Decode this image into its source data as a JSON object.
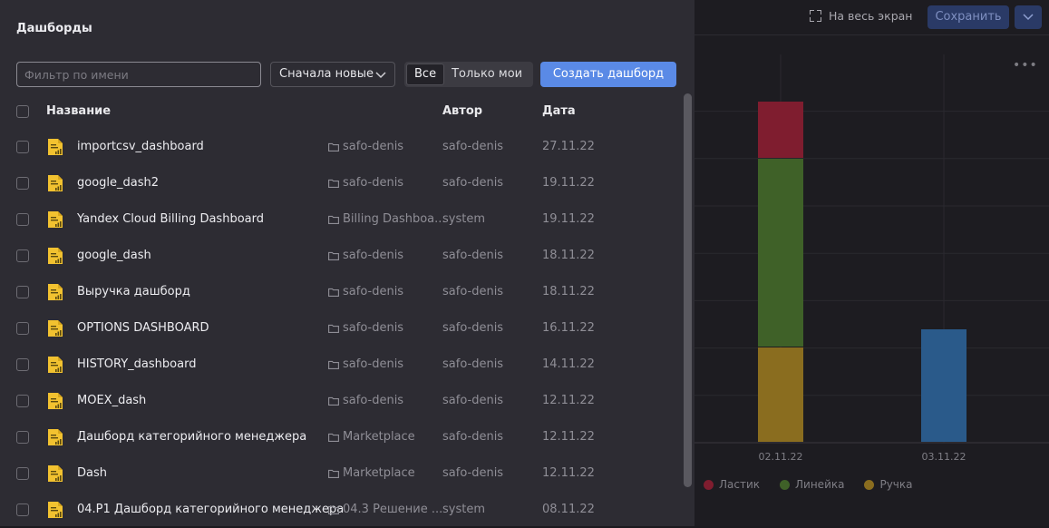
{
  "dashboard": {
    "fullscreen_label": "На весь экран",
    "save_label": "Сохранить",
    "more_label": "•••",
    "chart_data": {
      "type": "bar",
      "stacked": true,
      "categories": [
        "02.11.22",
        "03.11.22"
      ],
      "series": [
        {
          "name": "Ручка",
          "color": "#8a6d1f",
          "values": [
            105,
            0
          ]
        },
        {
          "name": "Линейка",
          "color": "#3f6128",
          "values": [
            208,
            0
          ]
        },
        {
          "name": "Ластик",
          "color": "#7f1d2f",
          "values": [
            63,
            0
          ]
        },
        {
          "name": "",
          "color": "#2a5a8a",
          "values": [
            0,
            125
          ]
        }
      ],
      "legend": [
        "Ластик",
        "Линейка",
        "Ручка"
      ],
      "legend_colors": [
        "#7f1d2f",
        "#3f6128",
        "#8a6d1f"
      ],
      "legend_position": "bottom-left",
      "grid": true
    }
  },
  "dialog": {
    "title": "Дашборды",
    "filter_placeholder": "Фильтр по имени",
    "filter_value": "",
    "sort_label": "Сначала новые",
    "segment_all": "Все",
    "segment_mine": "Только мои",
    "create_label": "Создать дашборд",
    "columns": {
      "name": "Название",
      "author": "Автор",
      "date": "Дата"
    },
    "rows": [
      {
        "name": "importcsv_dashboard",
        "folder": "safo-denis",
        "author": "safo-denis",
        "date": "27.11.22"
      },
      {
        "name": "google_dash2",
        "folder": "safo-denis",
        "author": "safo-denis",
        "date": "19.11.22"
      },
      {
        "name": "Yandex Cloud Billing Dashboard",
        "folder": "Billing Dashboa...",
        "author": "system",
        "date": "19.11.22"
      },
      {
        "name": "google_dash",
        "folder": "safo-denis",
        "author": "safo-denis",
        "date": "18.11.22"
      },
      {
        "name": "Выручка дашборд",
        "folder": "safo-denis",
        "author": "safo-denis",
        "date": "18.11.22"
      },
      {
        "name": "OPTIONS DASHBOARD",
        "folder": "safo-denis",
        "author": "safo-denis",
        "date": "16.11.22"
      },
      {
        "name": "HISTORY_dashboard",
        "folder": "safo-denis",
        "author": "safo-denis",
        "date": "14.11.22"
      },
      {
        "name": "MOEX_dash",
        "folder": "safo-denis",
        "author": "safo-denis",
        "date": "12.11.22"
      },
      {
        "name": "Дашборд категорийного менеджера",
        "folder": "Marketplace",
        "author": "safo-denis",
        "date": "12.11.22"
      },
      {
        "name": "Dash",
        "folder": "Marketplace",
        "author": "safo-denis",
        "date": "12.11.22"
      },
      {
        "name": "04.P1 Дашборд категорийного менеджера",
        "folder": "04.3 Решение ...",
        "author": "system",
        "date": "08.11.22"
      }
    ]
  }
}
